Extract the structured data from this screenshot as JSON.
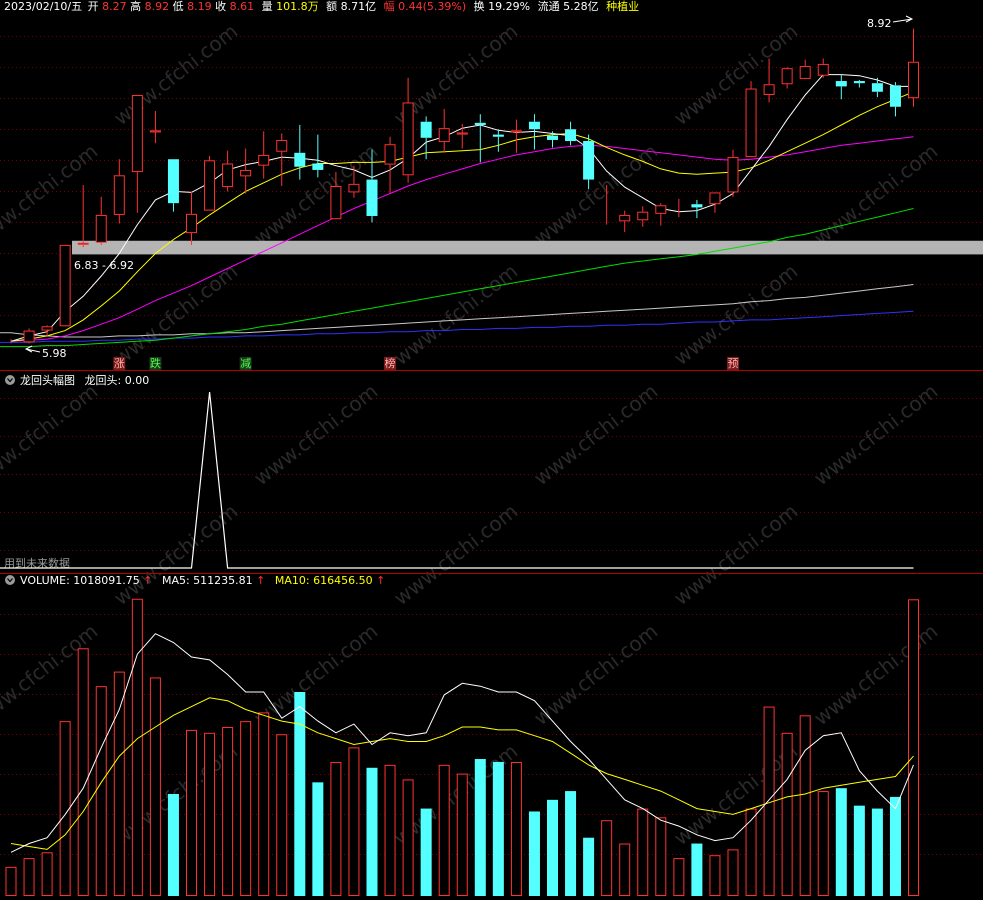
{
  "header": {
    "date": "2023/02/10/五",
    "open_label": "开",
    "open": "8.27",
    "high_label": "高",
    "high": "8.92",
    "low_label": "低",
    "low": "8.19",
    "close_label": "收",
    "close": "8.61",
    "vol_label": "量",
    "vol": "101.8万",
    "amt_label": "额",
    "amt": "8.71亿",
    "chg_label": "幅",
    "chg": "0.44(5.39%)",
    "turn_label": "换",
    "turn": "19.29%",
    "float_label": "流通",
    "float": "5.28亿",
    "sector": "种植业"
  },
  "annotations": {
    "high_mark": "8.92",
    "low_mark": "5.98",
    "band_label": "6.83 - 6.92",
    "markers": [
      {
        "text": "涨",
        "bar": 6,
        "kind": "up"
      },
      {
        "text": "跌",
        "bar": 8,
        "kind": "down"
      },
      {
        "text": "减",
        "bar": 13,
        "kind": "down"
      },
      {
        "text": "榜",
        "bar": 21,
        "kind": "up"
      },
      {
        "text": "预",
        "bar": 40,
        "kind": "up"
      }
    ]
  },
  "indicator": {
    "title": "龙回头幅图",
    "value_label": "龙回头: 0.00",
    "future_note": "用到未来数据"
  },
  "volume_panel": {
    "vol_label": "VOLUME: 1018091.75",
    "ma5_label": "MA5: 511235.81",
    "ma10_label": "MA10: 616456.50"
  },
  "watermark": "www.cfchi.com",
  "colors": {
    "up": "#ff3232",
    "down": "#54ffff",
    "ma5": "#ffffff",
    "ma10": "#ffff00",
    "ma20": "#ff00ff",
    "ma60": "#00dd00",
    "ma120": "#c8c8c8",
    "ma250": "#3030ff",
    "grid": "#7a0000",
    "band": "#b4b4b4",
    "accent": "#ffff00"
  },
  "chart_data": [
    {
      "type": "candlestick",
      "price_range": [
        5.9,
        9.0
      ],
      "candles": [
        {
          "o": 6.0,
          "h": 6.02,
          "l": 5.98,
          "c": 6.0
        },
        {
          "o": 5.99,
          "h": 6.12,
          "l": 5.98,
          "c": 6.1
        },
        {
          "o": 6.1,
          "h": 6.15,
          "l": 6.05,
          "c": 6.14
        },
        {
          "o": 6.14,
          "h": 6.9,
          "l": 6.14,
          "c": 6.9
        },
        {
          "o": 6.9,
          "h": 7.46,
          "l": 6.88,
          "c": 6.92
        },
        {
          "o": 6.92,
          "h": 7.35,
          "l": 6.9,
          "c": 7.18
        },
        {
          "o": 7.18,
          "h": 7.7,
          "l": 7.1,
          "c": 7.55
        },
        {
          "o": 7.58,
          "h": 8.3,
          "l": 7.2,
          "c": 8.3
        },
        {
          "o": 7.95,
          "h": 8.15,
          "l": 7.85,
          "c": 7.97
        },
        {
          "o": 7.7,
          "h": 7.7,
          "l": 7.21,
          "c": 7.29
        },
        {
          "o": 7.01,
          "h": 7.4,
          "l": 6.9,
          "c": 7.19
        },
        {
          "o": 7.22,
          "h": 7.73,
          "l": 7.22,
          "c": 7.69
        },
        {
          "o": 7.44,
          "h": 7.78,
          "l": 7.4,
          "c": 7.66
        },
        {
          "o": 7.54,
          "h": 7.8,
          "l": 7.38,
          "c": 7.6
        },
        {
          "o": 7.64,
          "h": 7.96,
          "l": 7.52,
          "c": 7.74
        },
        {
          "o": 7.77,
          "h": 7.94,
          "l": 7.45,
          "c": 7.88
        },
        {
          "o": 7.76,
          "h": 8.02,
          "l": 7.51,
          "c": 7.63
        },
        {
          "o": 7.66,
          "h": 7.93,
          "l": 7.53,
          "c": 7.6
        },
        {
          "o": 7.14,
          "h": 7.58,
          "l": 7.19,
          "c": 7.45
        },
        {
          "o": 7.39,
          "h": 7.64,
          "l": 7.34,
          "c": 7.47
        },
        {
          "o": 7.51,
          "h": 7.79,
          "l": 7.11,
          "c": 7.17
        },
        {
          "o": 7.65,
          "h": 7.91,
          "l": 7.38,
          "c": 7.84
        },
        {
          "o": 7.55,
          "h": 8.46,
          "l": 7.48,
          "c": 8.23
        },
        {
          "o": 8.05,
          "h": 8.1,
          "l": 7.7,
          "c": 7.9
        },
        {
          "o": 7.86,
          "h": 8.17,
          "l": 7.76,
          "c": 7.99
        },
        {
          "o": 7.93,
          "h": 8.03,
          "l": 7.8,
          "c": 7.95
        },
        {
          "o": 8.04,
          "h": 8.12,
          "l": 7.67,
          "c": 8.02
        },
        {
          "o": 7.93,
          "h": 7.98,
          "l": 7.77,
          "c": 7.91
        },
        {
          "o": 7.95,
          "h": 8.07,
          "l": 7.76,
          "c": 7.97
        },
        {
          "o": 8.05,
          "h": 8.12,
          "l": 7.79,
          "c": 7.98
        },
        {
          "o": 7.92,
          "h": 7.96,
          "l": 7.81,
          "c": 7.88
        },
        {
          "o": 7.98,
          "h": 8.05,
          "l": 7.83,
          "c": 7.87
        },
        {
          "o": 7.87,
          "h": 7.93,
          "l": 7.42,
          "c": 7.51
        },
        {
          "o": 7.14,
          "h": 7.46,
          "l": 7.09,
          "c": 7.14
        },
        {
          "o": 7.12,
          "h": 7.22,
          "l": 7.02,
          "c": 7.18
        },
        {
          "o": 7.13,
          "h": 7.26,
          "l": 7.07,
          "c": 7.21
        },
        {
          "o": 7.19,
          "h": 7.29,
          "l": 7.08,
          "c": 7.27
        },
        {
          "o": 7.25,
          "h": 7.33,
          "l": 7.16,
          "c": 7.25
        },
        {
          "o": 7.28,
          "h": 7.32,
          "l": 7.15,
          "c": 7.25
        },
        {
          "o": 7.28,
          "h": 7.35,
          "l": 7.2,
          "c": 7.39
        },
        {
          "o": 7.39,
          "h": 7.79,
          "l": 7.35,
          "c": 7.72
        },
        {
          "o": 7.72,
          "h": 8.43,
          "l": 7.72,
          "c": 8.36
        },
        {
          "o": 8.3,
          "h": 8.64,
          "l": 8.23,
          "c": 8.4
        },
        {
          "o": 8.4,
          "h": 8.56,
          "l": 8.36,
          "c": 8.55
        },
        {
          "o": 8.45,
          "h": 8.63,
          "l": 8.46,
          "c": 8.57
        },
        {
          "o": 8.48,
          "h": 8.64,
          "l": 8.46,
          "c": 8.59
        },
        {
          "o": 8.43,
          "h": 8.49,
          "l": 8.26,
          "c": 8.38
        },
        {
          "o": 8.43,
          "h": 8.44,
          "l": 8.37,
          "c": 8.41
        },
        {
          "o": 8.41,
          "h": 8.46,
          "l": 8.28,
          "c": 8.33
        },
        {
          "o": 8.39,
          "h": 8.42,
          "l": 8.1,
          "c": 8.19
        },
        {
          "o": 8.27,
          "h": 8.92,
          "l": 8.19,
          "c": 8.61
        }
      ],
      "ma5": [
        6.0,
        6.05,
        6.09,
        6.28,
        6.42,
        6.61,
        6.82,
        7.09,
        7.32,
        7.4,
        7.39,
        7.48,
        7.6,
        7.65,
        7.68,
        7.72,
        7.71,
        7.69,
        7.64,
        7.6,
        7.53,
        7.6,
        7.71,
        7.86,
        7.91,
        7.99,
        8.02,
        7.97,
        7.95,
        7.96,
        7.94,
        7.92,
        7.8,
        7.59,
        7.44,
        7.34,
        7.24,
        7.21,
        7.22,
        7.28,
        7.38,
        7.6,
        7.82,
        8.07,
        8.3,
        8.49,
        8.49,
        8.48,
        8.44,
        8.38,
        8.38
      ],
      "ma10": [
        6.0,
        6.02,
        6.05,
        6.1,
        6.2,
        6.33,
        6.47,
        6.65,
        6.82,
        6.95,
        7.06,
        7.18,
        7.29,
        7.4,
        7.48,
        7.56,
        7.62,
        7.66,
        7.66,
        7.67,
        7.67,
        7.68,
        7.72,
        7.76,
        7.77,
        7.78,
        7.79,
        7.83,
        7.88,
        7.91,
        7.93,
        7.94,
        7.89,
        7.81,
        7.74,
        7.68,
        7.61,
        7.57,
        7.56,
        7.57,
        7.58,
        7.62,
        7.69,
        7.77,
        7.85,
        7.93,
        8.02,
        8.11,
        8.19,
        8.26,
        8.33
      ],
      "ma20": [
        6.0,
        6.01,
        6.02,
        6.05,
        6.1,
        6.16,
        6.22,
        6.3,
        6.38,
        6.45,
        6.52,
        6.6,
        6.68,
        6.76,
        6.84,
        6.92,
        7.0,
        7.08,
        7.16,
        7.24,
        7.31,
        7.38,
        7.45,
        7.51,
        7.56,
        7.61,
        7.66,
        7.7,
        7.74,
        7.77,
        7.8,
        7.82,
        7.83,
        7.82,
        7.8,
        7.78,
        7.76,
        7.74,
        7.72,
        7.7,
        7.69,
        7.7,
        7.72,
        7.74,
        7.77,
        7.8,
        7.83,
        7.85,
        7.87,
        7.89,
        7.91
      ],
      "ma60": [
        5.95,
        5.95,
        5.96,
        5.96,
        5.97,
        5.98,
        5.99,
        6.0,
        6.01,
        6.03,
        6.05,
        6.07,
        6.09,
        6.11,
        6.14,
        6.16,
        6.19,
        6.22,
        6.25,
        6.28,
        6.31,
        6.34,
        6.37,
        6.4,
        6.43,
        6.46,
        6.49,
        6.52,
        6.55,
        6.58,
        6.61,
        6.64,
        6.67,
        6.7,
        6.73,
        6.75,
        6.77,
        6.79,
        6.81,
        6.84,
        6.87,
        6.9,
        6.93,
        6.97,
        7.0,
        7.04,
        7.08,
        7.12,
        7.16,
        7.2,
        7.24
      ],
      "ma120": [
        6.08,
        6.06,
        6.05,
        6.04,
        6.04,
        6.04,
        6.05,
        6.05,
        6.06,
        6.06,
        6.07,
        6.07,
        6.08,
        6.08,
        6.09,
        6.1,
        6.11,
        6.12,
        6.13,
        6.14,
        6.15,
        6.16,
        6.17,
        6.18,
        6.19,
        6.2,
        6.21,
        6.22,
        6.23,
        6.24,
        6.25,
        6.26,
        6.27,
        6.28,
        6.29,
        6.3,
        6.31,
        6.32,
        6.33,
        6.34,
        6.35,
        6.37,
        6.38,
        6.4,
        6.41,
        6.43,
        6.45,
        6.47,
        6.49,
        6.51,
        6.53
      ],
      "ma250": [
        5.99,
        5.99,
        6.0,
        6.0,
        6.0,
        6.01,
        6.01,
        6.02,
        6.02,
        6.03,
        6.03,
        6.04,
        6.04,
        6.05,
        6.05,
        6.06,
        6.06,
        6.07,
        6.07,
        6.08,
        6.08,
        6.09,
        6.09,
        6.1,
        6.1,
        6.11,
        6.11,
        6.12,
        6.12,
        6.13,
        6.13,
        6.14,
        6.14,
        6.15,
        6.15,
        6.16,
        6.16,
        6.17,
        6.18,
        6.18,
        6.19,
        6.2,
        6.2,
        6.21,
        6.22,
        6.23,
        6.24,
        6.25,
        6.26,
        6.27,
        6.28
      ],
      "highlight_band": [
        6.83,
        6.92
      ]
    },
    {
      "type": "line",
      "title": "龙回头幅图",
      "y_range": [
        0,
        1
      ],
      "values": [
        0,
        0,
        0,
        0,
        0,
        0,
        0,
        0,
        0,
        0,
        0,
        1,
        0,
        0,
        0,
        0,
        0,
        0,
        0,
        0,
        0,
        0,
        0,
        0,
        0,
        0,
        0,
        0,
        0,
        0,
        0,
        0,
        0,
        0,
        0,
        0,
        0,
        0,
        0,
        0,
        0,
        0,
        0,
        0,
        0,
        0,
        0,
        0,
        0,
        0,
        0
      ]
    },
    {
      "type": "bar",
      "title": "VOLUME",
      "y_range": [
        0,
        1050000
      ],
      "values": [
        100000,
        130000,
        150000,
        600000,
        850000,
        720000,
        770000,
        1020000,
        750000,
        350000,
        570000,
        560000,
        580000,
        600000,
        630000,
        555000,
        700000,
        390000,
        460000,
        510000,
        440000,
        450000,
        400000,
        300000,
        450000,
        420000,
        470000,
        460000,
        460000,
        290000,
        330000,
        360000,
        200000,
        260000,
        180000,
        300000,
        270000,
        130000,
        180000,
        140000,
        160000,
        300000,
        650000,
        560000,
        620000,
        360000,
        370000,
        310000,
        300000,
        340000,
        1018091.75
      ],
      "ma5": [
        150000,
        180000,
        200000,
        280000,
        370000,
        510000,
        640000,
        830000,
        900000,
        870000,
        820000,
        810000,
        760000,
        700000,
        700000,
        610000,
        650000,
        600000,
        560000,
        590000,
        520000,
        560000,
        550000,
        560000,
        690000,
        730000,
        720000,
        700000,
        700000,
        670000,
        600000,
        530000,
        470000,
        400000,
        330000,
        300000,
        260000,
        240000,
        210000,
        190000,
        200000,
        260000,
        330000,
        400000,
        500000,
        550000,
        560000,
        430000,
        360000,
        300000,
        450000
      ],
      "ma10": [
        180000,
        170000,
        160000,
        210000,
        290000,
        390000,
        480000,
        540000,
        580000,
        620000,
        650000,
        680000,
        670000,
        640000,
        620000,
        600000,
        590000,
        560000,
        540000,
        520000,
        530000,
        540000,
        530000,
        530000,
        550000,
        580000,
        580000,
        570000,
        570000,
        550000,
        530000,
        490000,
        450000,
        420000,
        400000,
        380000,
        360000,
        330000,
        300000,
        290000,
        280000,
        300000,
        320000,
        340000,
        350000,
        370000,
        380000,
        390000,
        400000,
        410000,
        480000
      ]
    }
  ]
}
